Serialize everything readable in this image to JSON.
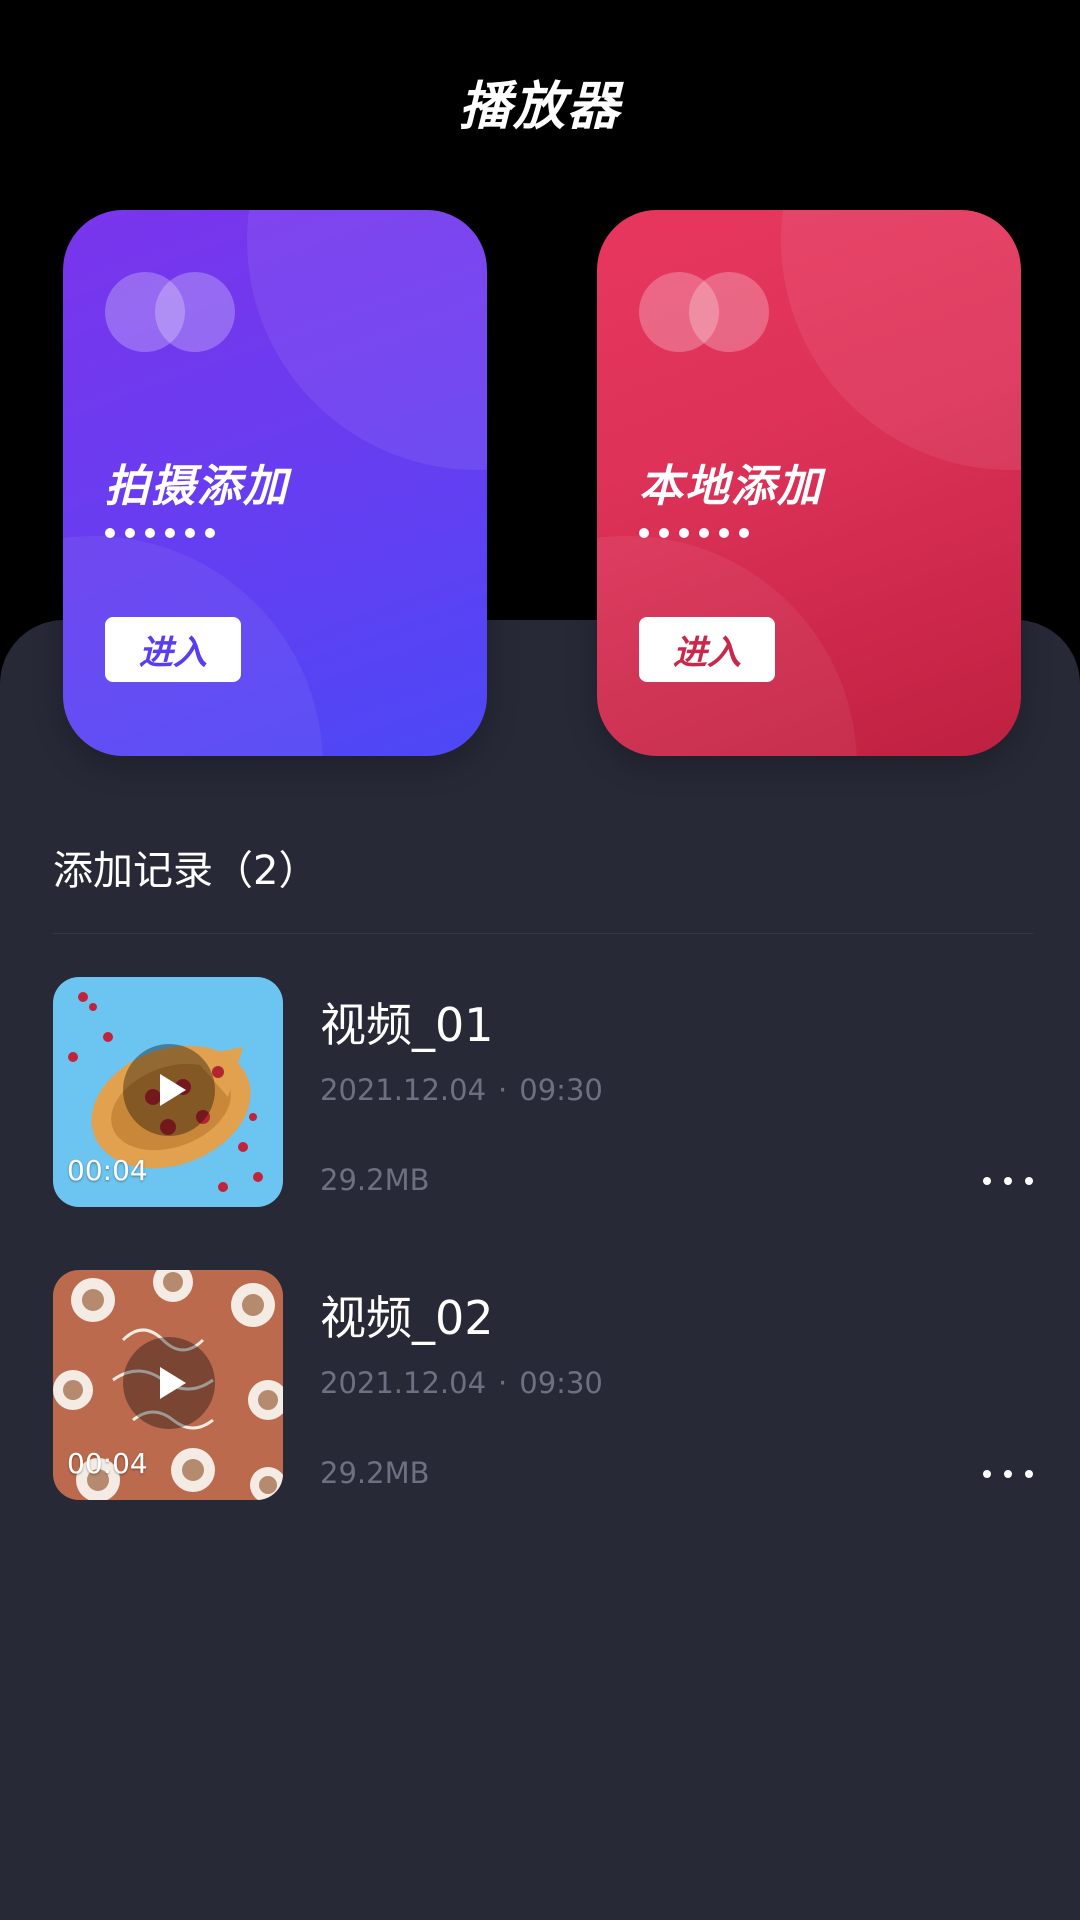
{
  "header": {
    "title": "播放器"
  },
  "cards": [
    {
      "title": "拍摄添加",
      "dots": "••••••",
      "button": "进入",
      "color": "#6a3cf0"
    },
    {
      "title": "本地添加",
      "dots": "••••••",
      "button": "进入",
      "color": "#dc3157"
    }
  ],
  "records": {
    "title": "添加记录（2）",
    "items": [
      {
        "name": "视频_01",
        "date": "2021.12.04",
        "time": "09:30",
        "size": "29.2MB",
        "duration": "00:04",
        "thumb_icon": "waffle-image"
      },
      {
        "name": "视频_02",
        "date": "2021.12.04",
        "time": "09:30",
        "size": "29.2MB",
        "duration": "00:04",
        "thumb_icon": "coffee-cups-image"
      }
    ]
  },
  "colors": {
    "panel_bg": "#272937",
    "meta_text": "#6d7080"
  }
}
